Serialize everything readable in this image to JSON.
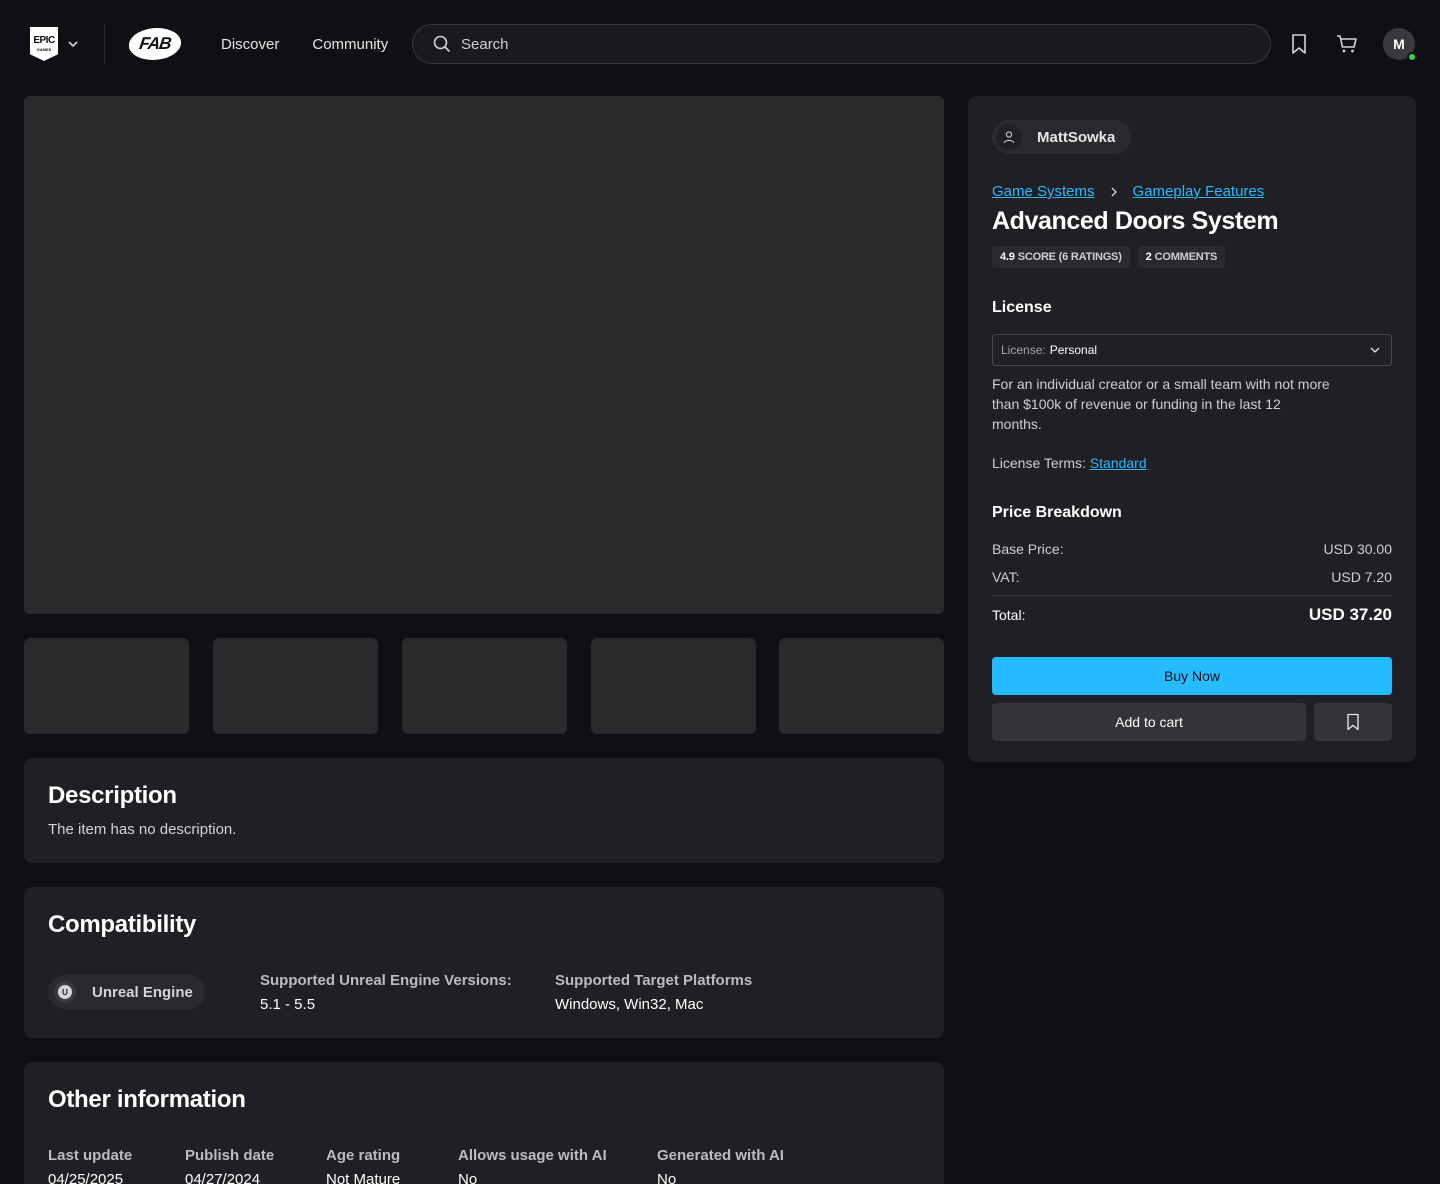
{
  "header": {
    "epic_logo_line1": "EPIC",
    "epic_logo_line2": "GAMES",
    "fab_logo": "FAB",
    "nav": [
      {
        "label": "Discover"
      },
      {
        "label": "Community"
      }
    ],
    "search": {
      "placeholder": "Search",
      "value": ""
    },
    "icons": [
      "chevron-down-icon",
      "search-icon",
      "bookmark-icon",
      "cart-icon"
    ],
    "avatar_initial": "M",
    "online_color": "#32d74b"
  },
  "gallery": {
    "thumbnail_count": 5
  },
  "description": {
    "title": "Description",
    "text": "The item has no description."
  },
  "compatibility": {
    "title": "Compatibility",
    "engine": "Unreal Engine",
    "engine_icon_letter": "U",
    "versions_label": "Supported Unreal Engine Versions:",
    "versions_value": "5.1 - 5.5",
    "platforms_label": "Supported Target Platforms",
    "platforms_value": "Windows, Win32, Mac"
  },
  "other_info": {
    "title": "Other information",
    "fields": [
      {
        "label": "Last update",
        "value": "04/25/2025"
      },
      {
        "label": "Publish date",
        "value": "04/27/2024"
      },
      {
        "label": "Age rating",
        "value": "Not Mature"
      },
      {
        "label": "Allows usage with AI",
        "value": "No"
      },
      {
        "label": "Generated with AI",
        "value": "No"
      }
    ]
  },
  "product": {
    "seller": "MattSowka",
    "breadcrumb": [
      "Game Systems",
      "Gameplay Features"
    ],
    "title": "Advanced Doors System",
    "rating_score": "4.9",
    "rating_text": "SCORE (6 RATINGS)",
    "comments_count": "2",
    "comments_text": "COMMENTS",
    "license_heading": "License",
    "license_select_label": "License:",
    "license_select_value": "Personal",
    "license_description": "For an individual creator or a small team with not more than $100k of revenue or funding in the last 12 months.",
    "license_terms_label": "License Terms:",
    "license_terms_link": "Standard",
    "price_heading": "Price Breakdown",
    "base_price_label": "Base Price:",
    "base_price_value": "USD 30.00",
    "vat_label": "VAT:",
    "vat_value": "USD 7.20",
    "total_label": "Total:",
    "total_value": "USD 37.20",
    "buy_label": "Buy Now",
    "add_to_cart_label": "Add to cart",
    "accent_color": "#26bbff"
  }
}
